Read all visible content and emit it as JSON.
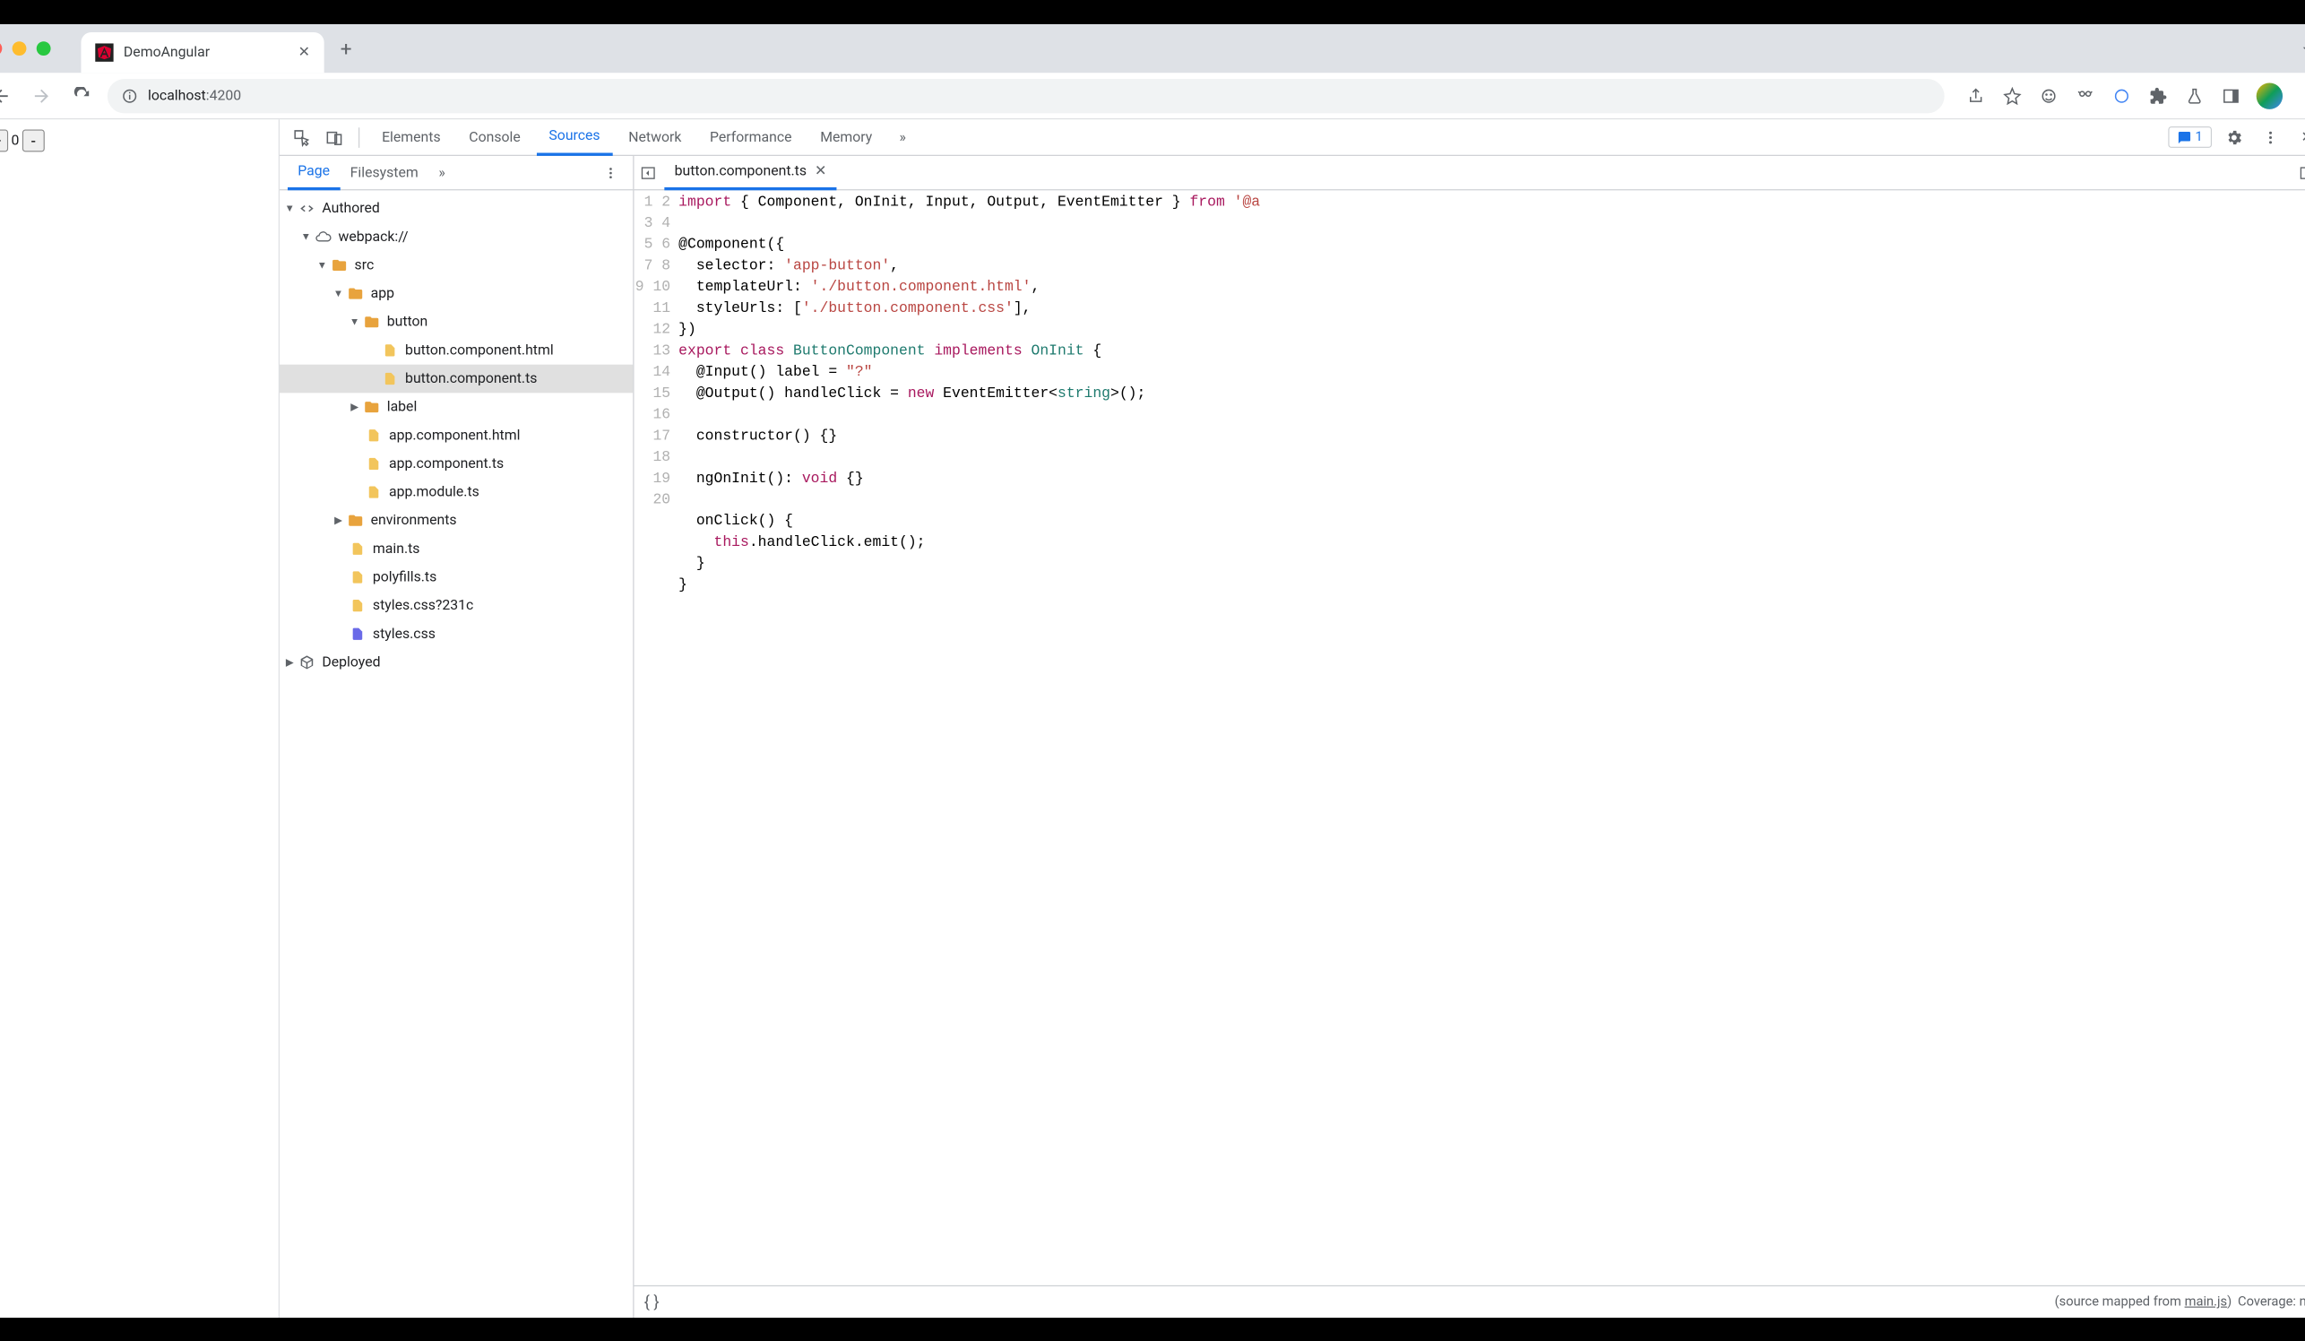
{
  "browser": {
    "tab_title": "DemoAngular",
    "url_prefix": "localhost",
    "url_port": ":4200"
  },
  "page": {
    "counter_value": "0",
    "plus_label": "+",
    "minus_label": "-"
  },
  "devtools": {
    "tabs": [
      "Elements",
      "Console",
      "Sources",
      "Network",
      "Performance",
      "Memory"
    ],
    "active_tab": "Sources",
    "issue_count": "1"
  },
  "sources_nav": {
    "tabs": [
      "Page",
      "Filesystem"
    ],
    "active": "Page"
  },
  "tree": {
    "root_authored": "Authored",
    "webpack": "webpack://",
    "src": "src",
    "app": "app",
    "button": "button",
    "button_html": "button.component.html",
    "button_ts": "button.component.ts",
    "label": "label",
    "app_html": "app.component.html",
    "app_ts": "app.component.ts",
    "app_module": "app.module.ts",
    "envs": "environments",
    "main": "main.ts",
    "polyfills": "polyfills.ts",
    "styles_q": "styles.css?231c",
    "styles": "styles.css",
    "deployed": "Deployed"
  },
  "editor": {
    "open_file": "button.component.ts",
    "lines": [
      [
        [
          "kw",
          "import"
        ],
        [
          "p",
          " { Component, OnInit, Input, Output, EventEmitter } "
        ],
        [
          "kw",
          "from"
        ],
        [
          "p",
          " "
        ],
        [
          "str",
          "'@a"
        ]
      ],
      [],
      [
        [
          "p",
          "@Component({"
        ]
      ],
      [
        [
          "p",
          "  selector: "
        ],
        [
          "str",
          "'app-button'"
        ],
        [
          "p",
          ","
        ]
      ],
      [
        [
          "p",
          "  templateUrl: "
        ],
        [
          "str",
          "'./button.component.html'"
        ],
        [
          "p",
          ","
        ]
      ],
      [
        [
          "p",
          "  styleUrls: ["
        ],
        [
          "str",
          "'./button.component.css'"
        ],
        [
          "p",
          "],"
        ]
      ],
      [
        [
          "p",
          "})"
        ]
      ],
      [
        [
          "kw",
          "export"
        ],
        [
          "p",
          " "
        ],
        [
          "kw",
          "class"
        ],
        [
          "p",
          " "
        ],
        [
          "cls",
          "ButtonComponent"
        ],
        [
          "p",
          " "
        ],
        [
          "kw",
          "implements"
        ],
        [
          "p",
          " "
        ],
        [
          "cls",
          "OnInit"
        ],
        [
          "p",
          " {"
        ]
      ],
      [
        [
          "p",
          "  @Input() label = "
        ],
        [
          "str",
          "\"?\""
        ]
      ],
      [
        [
          "p",
          "  @Output() handleClick = "
        ],
        [
          "new",
          "new"
        ],
        [
          "p",
          " EventEmitter<"
        ],
        [
          "type",
          "string"
        ],
        [
          "p",
          ">();"
        ]
      ],
      [],
      [
        [
          "p",
          "  constructor() {}"
        ]
      ],
      [],
      [
        [
          "p",
          "  ngOnInit(): "
        ],
        [
          "kw",
          "void"
        ],
        [
          "p",
          " {}"
        ]
      ],
      [],
      [
        [
          "p",
          "  onClick() {"
        ]
      ],
      [
        [
          "p",
          "    "
        ],
        [
          "this",
          "this"
        ],
        [
          "p",
          ".handleClick.emit();"
        ]
      ],
      [
        [
          "p",
          "  }"
        ]
      ],
      [
        [
          "p",
          "}"
        ]
      ],
      []
    ]
  },
  "footer": {
    "source_mapped_prefix": "(source mapped from ",
    "source_mapped_link": "main.js",
    "source_mapped_suffix": ")",
    "coverage": "Coverage: n/a"
  }
}
